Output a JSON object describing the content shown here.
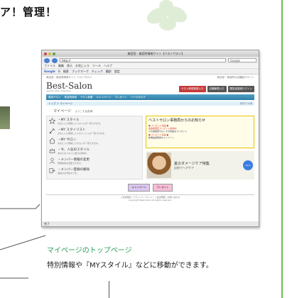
{
  "header": {
    "heading_fragment": "ア！管理！"
  },
  "browser": {
    "window_title": "美容室・美容院情報サイト【ベストサロン】",
    "address": "http://",
    "search_placeholder": "Google",
    "menu": [
      "ファイル",
      "編集",
      "表示",
      "お気に入り",
      "ツール",
      "ヘルプ"
    ],
    "google_bar": [
      "Google",
      "G",
      "検索",
      "ブックマーク",
      "チェック",
      "翻訳",
      "設定"
    ],
    "status_text": "完了"
  },
  "site": {
    "top_note": "美容室・美容院検索サイト ベストサロン",
    "top_right_note": "美容室・美容院の店舗紹介サイト",
    "logo": "Best-Salon",
    "logo_sub": "beauty salon magazine",
    "top_buttons": [
      "サロン新規登録入口",
      "店舗管理入口",
      "閲覧者登録ログイン"
    ],
    "global_nav": [
      "美容サロン",
      "美容院検索",
      "サロン新着",
      "キャンペーン",
      "プレゼント",
      "ヘアカタログ"
    ],
    "crumb_left": "トップ ＞ マイページ",
    "crumb_right": "ログイン中",
    "mypage_title": "マイページ",
    "mypage_welcome": "ようこそ会員様！",
    "menu_items": [
      {
        "icon": "star-icon",
        "title": "・MY スタイル",
        "desc": "お気に入り登録したスタイルが一覧できます。"
      },
      {
        "icon": "brush-icon",
        "title": "・MY スタイリスト",
        "desc": "お気に入り登録したスタイリストが一覧できます。"
      },
      {
        "icon": "house-icon",
        "title": "・MY サロン",
        "desc": "お気に入り登録したサロンが一覧できます。"
      },
      {
        "icon": "crown-icon",
        "title": "・今、人気のスタイル",
        "desc": "あなたのスタイル選びの参考に"
      },
      {
        "icon": "person-icon",
        "title": "・メンバー情報の変更",
        "desc": "登録情報も変更できます。"
      },
      {
        "icon": "exit-icon",
        "title": "・メンバー登録の解除",
        "desc": "退会のお手続きです。"
      }
    ],
    "news_title": "ベストサロン事務局からのお知らせ",
    "news_lines": [
      "● プレゼント企画 ●",
      "会員様限定プレゼント実施中！",
      "人気美容室サロンでの商品をプレゼント",
      "● プレゼント企画 ●",
      "新規会員登録キャンペーン"
    ],
    "banner_title": "夏のダメージケア特集",
    "banner_desc": "自宅でヘアケア",
    "banner_badge": "Click",
    "promo_left": "キャンペーン",
    "promo_right": "プレゼント",
    "footer_line1": "ご利用規約 | プライバシーポリシー | 会社概要 | お問い合わせ",
    "footer_line2": "Copyright Best-Salon All rights reserved."
  },
  "caption": {
    "title": "マイページのトップページ",
    "body": "特別情報や『MYスタイル』などに移動ができます。"
  },
  "colors": {
    "accent_green": "#2a9d55",
    "rule_green": "#6abf4b",
    "nav_blue": "#2f7fa5"
  }
}
